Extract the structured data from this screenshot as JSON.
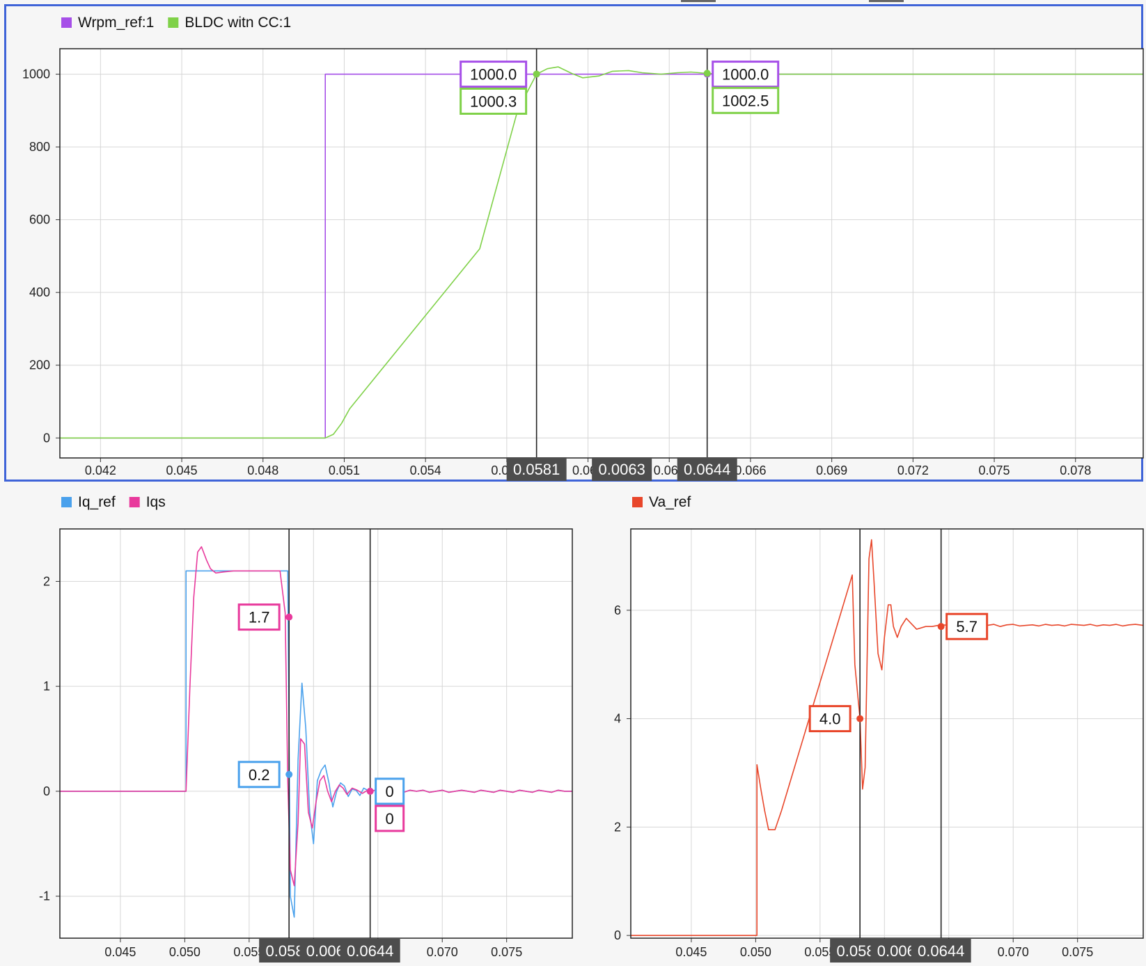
{
  "chart_data": [
    {
      "type": "line",
      "id": "top",
      "legend_position": "top-left",
      "grid": true,
      "xlim": [
        0.0405,
        0.0805
      ],
      "ylim": [
        -55,
        1070
      ],
      "x_ticks": [
        "0.042",
        "0.045",
        "0.048",
        "0.051",
        "0.054",
        "0.057",
        "0.060",
        "0.063",
        "0.066",
        "0.069",
        "0.072",
        "0.075",
        "0.078"
      ],
      "x_tick_values": [
        0.042,
        0.045,
        0.048,
        0.051,
        0.054,
        0.057,
        0.06,
        0.063,
        0.066,
        0.069,
        0.072,
        0.075,
        0.078
      ],
      "y_ticks": [
        "0",
        "200",
        "400",
        "600",
        "800",
        "1000"
      ],
      "y_tick_values": [
        0,
        200,
        400,
        600,
        800,
        1000
      ],
      "series": [
        {
          "name": "Wrpm_ref:1",
          "color": "#a64fe8",
          "x": [
            0.0405,
            0.0503,
            0.0503,
            0.0805
          ],
          "y": [
            0,
            0,
            1000,
            1000
          ]
        },
        {
          "name": "BLDC witn CC:1",
          "color": "#7fd148",
          "x": [
            0.0405,
            0.0503,
            0.0506,
            0.0509,
            0.0512,
            0.056,
            0.0574,
            0.0581,
            0.0585,
            0.0589,
            0.0594,
            0.0598,
            0.0604,
            0.0609,
            0.0615,
            0.062,
            0.0627,
            0.0633,
            0.0638,
            0.0644,
            0.0652,
            0.0805
          ],
          "y": [
            0,
            0,
            10,
            40,
            80,
            520,
            900,
            1000,
            1015,
            1020,
            1002,
            990,
            995,
            1008,
            1010,
            1004,
            1000,
            1004,
            1006,
            1002,
            1000,
            1000
          ]
        }
      ],
      "cursors": [
        {
          "x_label": "0.0581",
          "x": 0.0581,
          "values": [
            {
              "text": "1000.0",
              "color": "#a64fe8",
              "y": 1000
            },
            {
              "text": "1000.3",
              "color": "#7fd148",
              "y": 1000.3
            }
          ]
        },
        {
          "x_label": "0.0644",
          "x": 0.0644,
          "values": [
            {
              "text": "1000.0",
              "color": "#a64fe8",
              "y": 1000
            },
            {
              "text": "1002.5",
              "color": "#7fd148",
              "y": 1002.5
            }
          ]
        }
      ],
      "delta_label": "0.0063"
    },
    {
      "type": "line",
      "id": "bl",
      "legend_position": "top-left",
      "grid": true,
      "xlim": [
        0.0403,
        0.0801
      ],
      "ylim": [
        -1.4,
        2.5
      ],
      "x_ticks": [
        "0.045",
        "0.050",
        "0.055",
        "0.060",
        "0.065",
        "0.070",
        "0.075"
      ],
      "x_tick_values": [
        0.045,
        0.05,
        0.055,
        0.06,
        0.065,
        0.07,
        0.075
      ],
      "y_ticks": [
        "-1",
        "0",
        "1",
        "2"
      ],
      "y_tick_values": [
        -1,
        0,
        1,
        2
      ],
      "series": [
        {
          "name": "Iq_ref",
          "color": "#4aa1ec",
          "x": [
            0.0403,
            0.0501,
            0.0501,
            0.058,
            0.0582,
            0.0585,
            0.0588,
            0.0591,
            0.0594,
            0.0597,
            0.06,
            0.0603,
            0.0606,
            0.0609,
            0.0612,
            0.0615,
            0.0618,
            0.0621,
            0.0624,
            0.0627,
            0.063,
            0.0633,
            0.0636,
            0.0639,
            0.0642,
            0.0644,
            0.0648,
            0.0655,
            0.066,
            0.0665,
            0.067,
            0.0675,
            0.068,
            0.0685,
            0.069,
            0.0695,
            0.07,
            0.0705,
            0.071,
            0.0715,
            0.072,
            0.0725,
            0.073,
            0.0735,
            0.074,
            0.0745,
            0.075,
            0.0755,
            0.076,
            0.0765,
            0.077,
            0.0775,
            0.078,
            0.0785,
            0.079,
            0.0795,
            0.0801
          ],
          "y": [
            0,
            0,
            2.1,
            2.1,
            -1.0,
            -1.2,
            0.3,
            1.03,
            0.6,
            -0.2,
            -0.5,
            0.1,
            0.2,
            0.25,
            0.08,
            -0.15,
            0.0,
            0.08,
            0.05,
            -0.05,
            0.02,
            0.01,
            -0.04,
            0.03,
            0.01,
            0.0,
            0.01,
            -0.01,
            0.01,
            0.0,
            -0.01,
            0.01,
            0.0,
            0.01,
            -0.01,
            0.0,
            0.01,
            -0.01,
            0.0,
            0.01,
            0.0,
            -0.01,
            0.01,
            0.0,
            -0.01,
            0.01,
            0.0,
            -0.01,
            0.01,
            0.0,
            -0.01,
            0.01,
            0.0,
            -0.01,
            0.01,
            0.0,
            0.0
          ]
        },
        {
          "name": "Iqs",
          "color": "#e8399c",
          "x": [
            0.0403,
            0.0501,
            0.0504,
            0.0507,
            0.051,
            0.0513,
            0.0517,
            0.052,
            0.0524,
            0.053,
            0.0538,
            0.0546,
            0.0574,
            0.0578,
            0.058,
            0.0582,
            0.0585,
            0.0588,
            0.059,
            0.0593,
            0.0596,
            0.0599,
            0.0602,
            0.0605,
            0.0608,
            0.0611,
            0.0614,
            0.0617,
            0.062,
            0.0623,
            0.0626,
            0.063,
            0.0634,
            0.0638,
            0.0642,
            0.0644,
            0.0648,
            0.0655,
            0.066,
            0.0665,
            0.067,
            0.0675,
            0.068,
            0.0685,
            0.069,
            0.0695,
            0.07,
            0.0705,
            0.071,
            0.0715,
            0.072,
            0.0725,
            0.073,
            0.0735,
            0.074,
            0.0745,
            0.075,
            0.0755,
            0.076,
            0.0765,
            0.077,
            0.0775,
            0.078,
            0.0785,
            0.079,
            0.0795,
            0.0801
          ],
          "y": [
            0,
            0,
            1.0,
            1.85,
            2.28,
            2.33,
            2.2,
            2.12,
            2.08,
            2.09,
            2.1,
            2.1,
            2.1,
            1.7,
            0.1,
            -0.75,
            -0.9,
            -0.3,
            0.5,
            0.45,
            -0.2,
            -0.35,
            -0.1,
            0.1,
            0.15,
            0.0,
            -0.1,
            0.0,
            0.06,
            0.03,
            -0.03,
            0.03,
            0.01,
            -0.02,
            0.01,
            0.0,
            0.01,
            -0.01,
            0.01,
            0.0,
            -0.01,
            0.01,
            0.0,
            0.01,
            -0.01,
            0.0,
            0.01,
            -0.01,
            0.0,
            0.01,
            0.0,
            -0.01,
            0.01,
            0.0,
            -0.01,
            0.01,
            0.0,
            -0.01,
            0.01,
            0.0,
            -0.01,
            0.01,
            0.0,
            -0.01,
            0.01,
            0.0,
            0.0
          ]
        }
      ],
      "cursors": [
        {
          "x_label": "0.0581",
          "x": 0.0581,
          "values": [
            {
              "text": "1.7",
              "color": "#e8399c",
              "y": 1.66
            },
            {
              "text": "0.2",
              "color": "#4aa1ec",
              "y": 0.16
            }
          ]
        },
        {
          "x_label": "0.0644",
          "x": 0.0644,
          "values": [
            {
              "text": "0",
              "color": "#4aa1ec",
              "y": 0
            },
            {
              "text": "0",
              "color": "#e8399c",
              "y": 0
            }
          ]
        }
      ],
      "delta_label": "0.0063"
    },
    {
      "type": "line",
      "id": "br",
      "legend_position": "top-left",
      "grid": true,
      "xlim": [
        0.0403,
        0.0801
      ],
      "ylim": [
        -0.05,
        7.5
      ],
      "x_ticks": [
        "0.045",
        "0.050",
        "0.055",
        "0.060",
        "0.065",
        "0.070",
        "0.075"
      ],
      "x_tick_values": [
        0.045,
        0.05,
        0.055,
        0.06,
        0.065,
        0.07,
        0.075
      ],
      "y_ticks": [
        "0",
        "2",
        "4",
        "6"
      ],
      "y_tick_values": [
        0,
        2,
        4,
        6
      ],
      "series": [
        {
          "name": "Va_ref",
          "color": "#e8462a",
          "x": [
            0.0403,
            0.0501,
            0.0501,
            0.0504,
            0.0507,
            0.051,
            0.0515,
            0.052,
            0.0575,
            0.0577,
            0.0581,
            0.0583,
            0.0585,
            0.0588,
            0.059,
            0.0592,
            0.0595,
            0.0598,
            0.06,
            0.0603,
            0.0605,
            0.0607,
            0.061,
            0.0613,
            0.0617,
            0.0621,
            0.0625,
            0.0632,
            0.0637,
            0.0644,
            0.0652,
            0.066,
            0.0665,
            0.067,
            0.0675,
            0.068,
            0.0685,
            0.069,
            0.0695,
            0.07,
            0.0705,
            0.071,
            0.0715,
            0.072,
            0.0725,
            0.073,
            0.0735,
            0.074,
            0.0745,
            0.075,
            0.0755,
            0.076,
            0.0765,
            0.077,
            0.0775,
            0.078,
            0.0785,
            0.079,
            0.0795,
            0.0801
          ],
          "y": [
            0,
            0,
            3.15,
            2.7,
            2.3,
            1.95,
            1.95,
            2.3,
            6.65,
            5.0,
            4.0,
            2.7,
            3.1,
            6.95,
            7.3,
            6.5,
            5.2,
            4.9,
            5.5,
            6.1,
            6.1,
            5.7,
            5.5,
            5.7,
            5.85,
            5.75,
            5.65,
            5.7,
            5.7,
            5.73,
            5.72,
            5.72,
            5.73,
            5.7,
            5.73,
            5.72,
            5.74,
            5.7,
            5.73,
            5.74,
            5.71,
            5.72,
            5.73,
            5.71,
            5.74,
            5.72,
            5.73,
            5.71,
            5.74,
            5.73,
            5.72,
            5.74,
            5.71,
            5.73,
            5.72,
            5.74,
            5.71,
            5.73,
            5.74,
            5.72
          ]
        }
      ],
      "cursors": [
        {
          "x_label": "0.0581",
          "x": 0.0581,
          "values": [
            {
              "text": "4.0",
              "color": "#e8462a",
              "y": 4.0
            }
          ]
        },
        {
          "x_label": "0.0644",
          "x": 0.0644,
          "values": [
            {
              "text": "5.7",
              "color": "#e8462a",
              "y": 5.7
            }
          ]
        }
      ],
      "delta_label": "0.0063"
    }
  ]
}
